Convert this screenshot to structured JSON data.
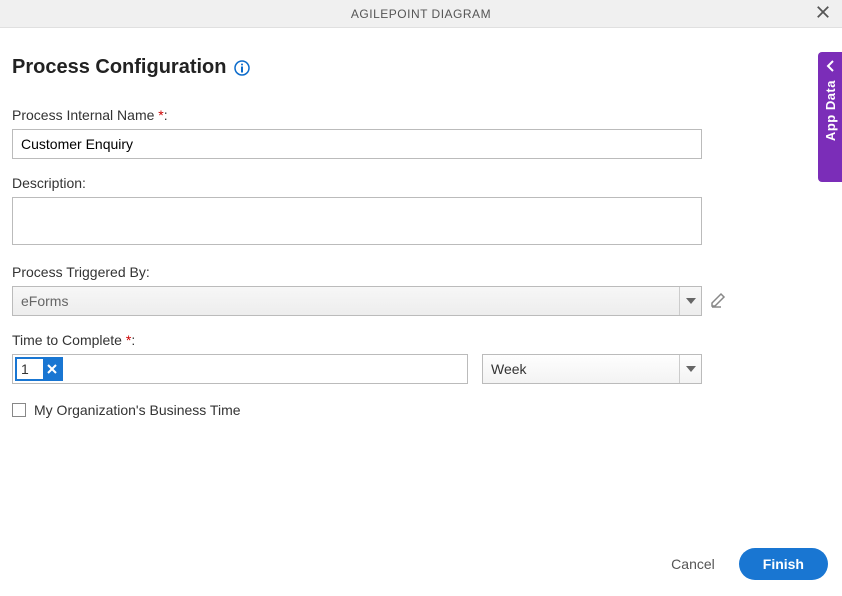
{
  "header": {
    "title": "AGILEPOINT DIAGRAM"
  },
  "pageTitle": "Process Configuration",
  "labels": {
    "processInternalName": "Process Internal Name",
    "description": "Description:",
    "processTriggeredBy": "Process Triggered By:",
    "timeToComplete": "Time to Complete",
    "businessTime": "My Organization's Business Time",
    "colon": ":",
    "requiredMark": "*"
  },
  "values": {
    "processInternalName": "Customer Enquiry",
    "description": "",
    "processTriggeredBy": "eForms",
    "timeToComplete": "1",
    "timeUnit": "Week",
    "businessTimeChecked": false
  },
  "footer": {
    "cancel": "Cancel",
    "finish": "Finish"
  },
  "sideTab": {
    "label": "App Data"
  }
}
